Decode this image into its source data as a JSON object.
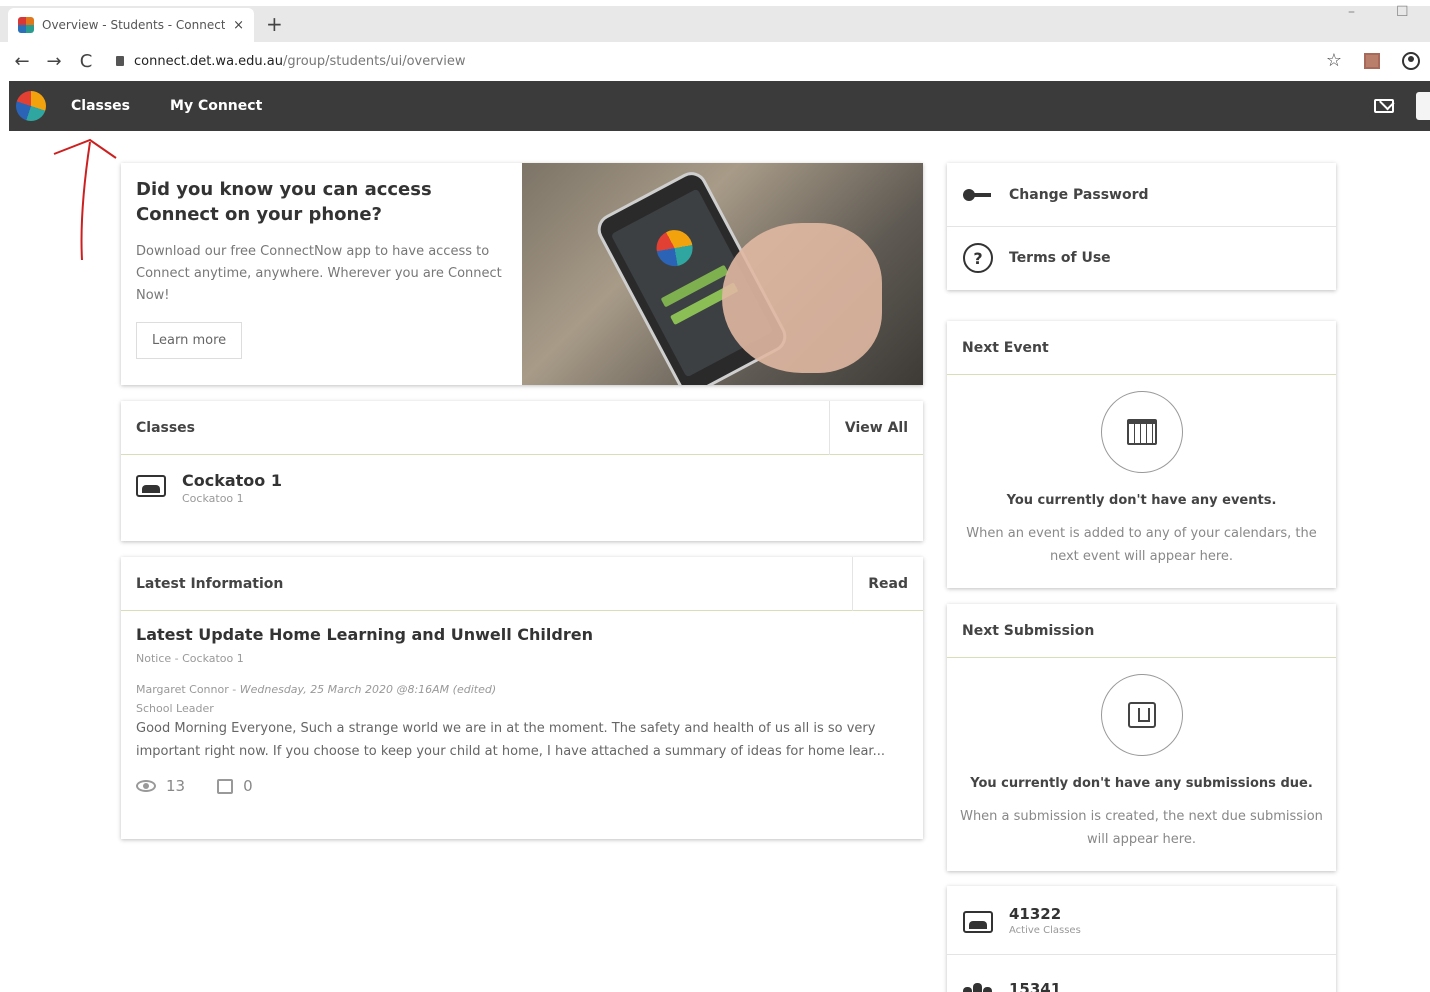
{
  "browser": {
    "tab_title": "Overview - Students - Connect",
    "tab_close": "×",
    "new_tab": "+",
    "url_host": "connect.det.wa.edu.au",
    "url_path": "/group/students/ui/overview",
    "back": "←",
    "forward": "→",
    "reload": "C",
    "star": "☆",
    "minimize": "–",
    "maximize": "☐"
  },
  "appbar": {
    "nav": [
      "Classes",
      "My Connect"
    ]
  },
  "promo": {
    "title": "Did you know you can access Connect on your phone?",
    "description": "Download our free ConnectNow app to have access to Connect anytime, anywhere. Wherever you are Connect Now!",
    "button_label": "Learn more"
  },
  "classes": {
    "title": "Classes",
    "action": "View All",
    "items": [
      {
        "name": "Cockatoo 1",
        "sub": "Cockatoo 1"
      }
    ]
  },
  "latest_info": {
    "title": "Latest Information",
    "action": "Read",
    "post": {
      "title": "Latest Update Home Learning and Unwell Children",
      "meta": "Notice - Cockatoo 1",
      "author": "Margaret Connor",
      "date": "Wednesday, 25 March 2020 @8:16AM",
      "edited": "(edited)",
      "role": "School Leader",
      "text": "Good Morning Everyone, Such a strange world we are in at the moment. The safety and health of us all is so very important right now. If you choose to keep your child at home, I have attached a summary of ideas for home lear...",
      "views": "13",
      "comments": "0"
    }
  },
  "links": [
    {
      "label": "Change Password",
      "icon": "key-icon"
    },
    {
      "label": "Terms of Use",
      "icon": "help-icon"
    }
  ],
  "next_event": {
    "title": "Next Event",
    "empty_title": "You currently don't have any events.",
    "empty_desc": "When an event is added to any of your calendars, the next event will appear here."
  },
  "next_submission": {
    "title": "Next Submission",
    "empty_title": "You currently don't have any submissions due.",
    "empty_desc": "When a submission is created, the next due submission will appear here."
  },
  "stats": [
    {
      "value": "41322",
      "label": "Active Classes"
    },
    {
      "value": "15341",
      "label": ""
    }
  ],
  "colors": {
    "appbar": "#3b3b3b",
    "card_divider": "#d6dfb5",
    "annotation": "#cc2020"
  }
}
